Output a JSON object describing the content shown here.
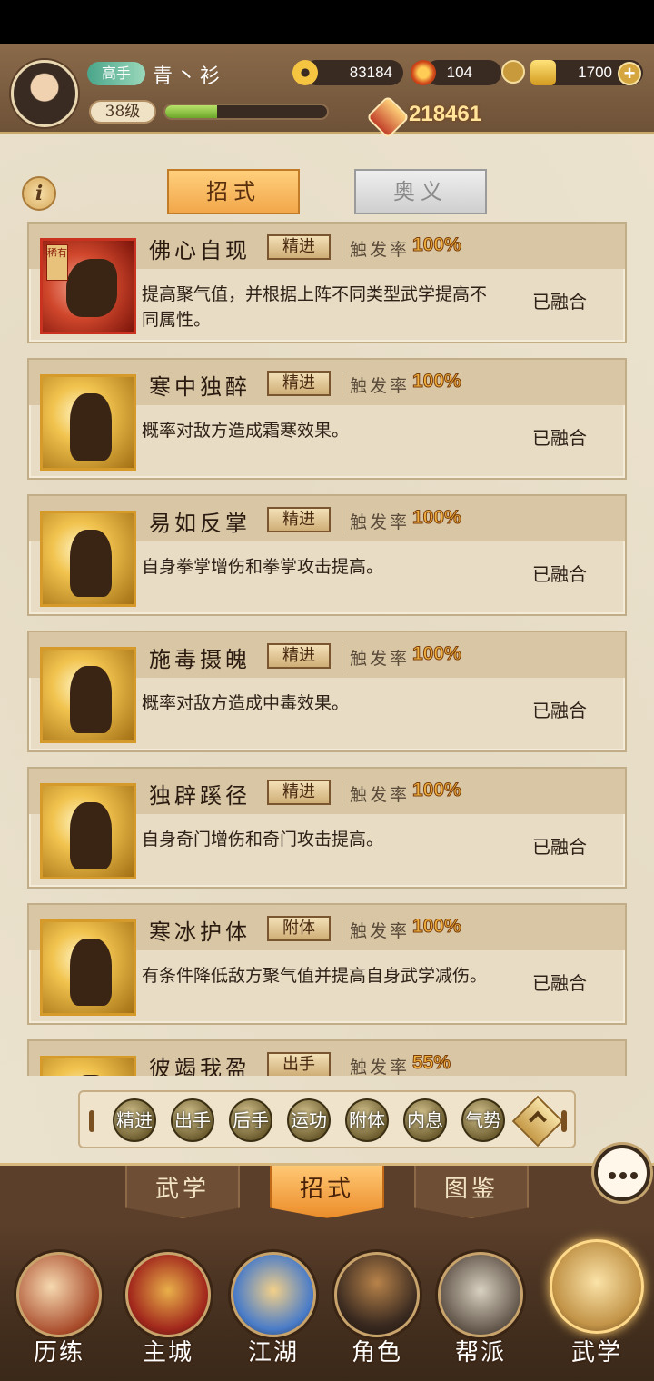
{
  "header": {
    "rank_label": "高手",
    "player_name": "青丶衫",
    "level": "38级",
    "xp_fraction": 0.32,
    "copper": "83184",
    "energy": "104",
    "gold": "1700",
    "plus_label": "+",
    "power": "218461"
  },
  "tabs": {
    "info_label": "i",
    "moves_label": "招式",
    "secrets_label": "奥义"
  },
  "skills": [
    {
      "name": "佛心自现",
      "tag": "精进",
      "trigger_label": "触发率",
      "trigger_value": "100%",
      "desc": "提高聚气值，并根据上阵不同类型武学提高不同属性。",
      "status": "已融合",
      "rare": "稀有"
    },
    {
      "name": "寒中独醉",
      "tag": "精进",
      "trigger_label": "触发率",
      "trigger_value": "100%",
      "desc": "概率对敌方造成霜寒效果。",
      "status": "已融合"
    },
    {
      "name": "易如反掌",
      "tag": "精进",
      "trigger_label": "触发率",
      "trigger_value": "100%",
      "desc": "自身拳掌增伤和拳掌攻击提高。",
      "status": "已融合"
    },
    {
      "name": "施毒摄魄",
      "tag": "精进",
      "trigger_label": "触发率",
      "trigger_value": "100%",
      "desc": "概率对敌方造成中毒效果。",
      "status": "已融合"
    },
    {
      "name": "独辟蹊径",
      "tag": "精进",
      "trigger_label": "触发率",
      "trigger_value": "100%",
      "desc": "自身奇门增伤和奇门攻击提高。",
      "status": "已融合"
    },
    {
      "name": "寒冰护体",
      "tag": "附体",
      "trigger_label": "触发率",
      "trigger_value": "100%",
      "desc": "有条件降低敌方聚气值并提高自身武学减伤。",
      "status": "已融合"
    },
    {
      "name": "彼竭我盈",
      "tag": "出手",
      "trigger_label": "触发率",
      "trigger_value": "55%",
      "desc": "",
      "status": ""
    }
  ],
  "filters": [
    "精进",
    "出手",
    "后手",
    "运功",
    "附体",
    "内息",
    "气势"
  ],
  "subtabs": [
    "武学",
    "招式",
    "图鉴"
  ],
  "nav": [
    "历练",
    "主城",
    "江湖",
    "角色",
    "帮派",
    "武学"
  ],
  "colors": {
    "accent_orange": "#f2a74a",
    "trigger_gold": "#f1b13e",
    "xp_green": "#6ca72a",
    "panel_brown": "#5b3f2a"
  },
  "icons": {
    "chat": "chat-bubble-icon",
    "info": "info-icon",
    "collapse": "chevron-up-icon"
  }
}
